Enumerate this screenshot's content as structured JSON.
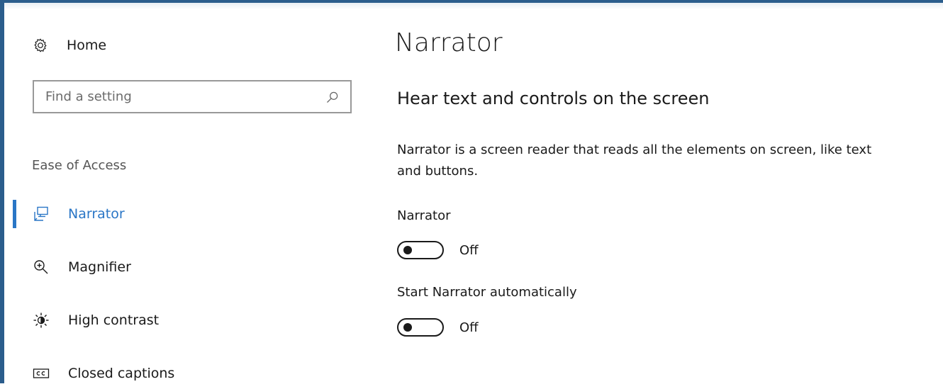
{
  "sidebar": {
    "home_label": "Home",
    "search_placeholder": "Find a setting",
    "section_label": "Ease of Access",
    "items": [
      {
        "label": "Narrator",
        "icon": "narrator-icon",
        "active": true
      },
      {
        "label": "Magnifier",
        "icon": "magnifier-icon",
        "active": false
      },
      {
        "label": "High contrast",
        "icon": "high-contrast-icon",
        "active": false
      },
      {
        "label": "Closed captions",
        "icon": "closed-captions-icon",
        "active": false
      }
    ]
  },
  "main": {
    "title": "Narrator",
    "subheading": "Hear text and controls on the screen",
    "description": "Narrator is a screen reader that reads all the elements on screen, like text and buttons.",
    "settings": [
      {
        "label": "Narrator",
        "state": "Off"
      },
      {
        "label": "Start Narrator automatically",
        "state": "Off"
      }
    ]
  },
  "colors": {
    "accent": "#2a76c6",
    "window_border": "#2b5d8c"
  }
}
